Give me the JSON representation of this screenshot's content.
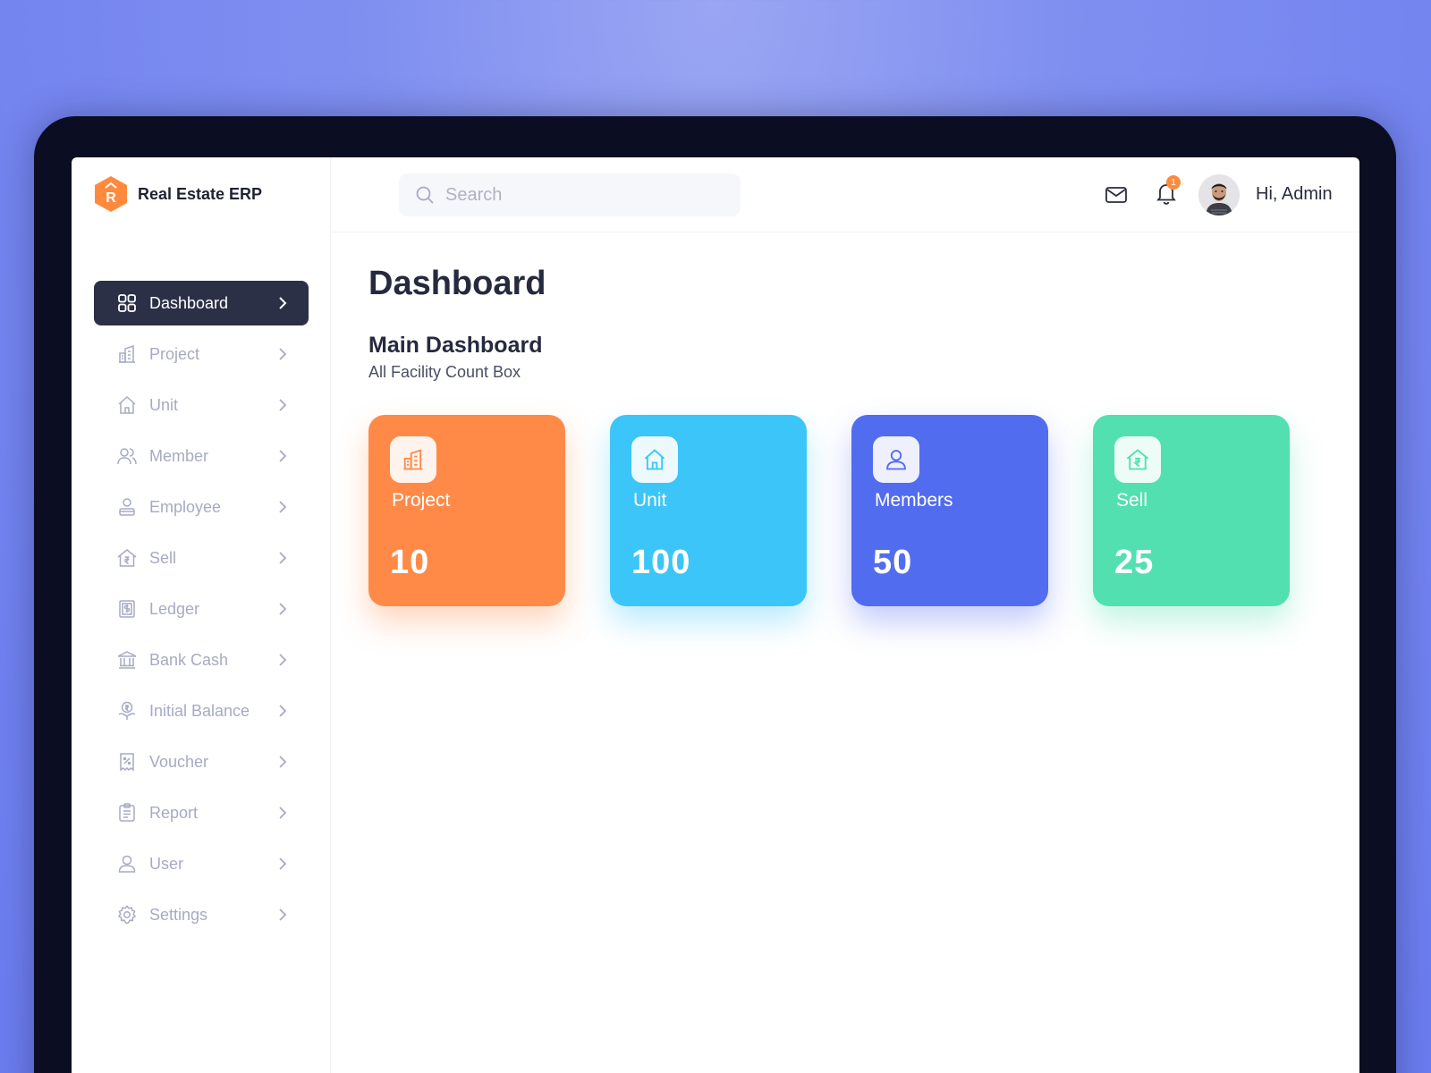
{
  "app": {
    "name": "Real Estate ERP",
    "logo_letter": "R"
  },
  "search": {
    "placeholder": "Search"
  },
  "header": {
    "notification_count": "1",
    "greeting": "Hi, Admin"
  },
  "sidebar": {
    "items": [
      {
        "label": "Dashboard",
        "icon": "grid-icon",
        "active": true
      },
      {
        "label": "Project",
        "icon": "building-icon"
      },
      {
        "label": "Unit",
        "icon": "home-icon"
      },
      {
        "label": "Member",
        "icon": "users-icon"
      },
      {
        "label": "Employee",
        "icon": "employee-icon"
      },
      {
        "label": "Sell",
        "icon": "house-rupee-icon"
      },
      {
        "label": "Ledger",
        "icon": "ledger-icon"
      },
      {
        "label": "Bank Cash",
        "icon": "bank-icon"
      },
      {
        "label": "Initial Balance",
        "icon": "balance-icon"
      },
      {
        "label": "Voucher",
        "icon": "voucher-icon"
      },
      {
        "label": "Report",
        "icon": "report-icon"
      },
      {
        "label": "User",
        "icon": "user-icon"
      },
      {
        "label": "Settings",
        "icon": "gear-icon"
      }
    ]
  },
  "main": {
    "title": "Dashboard",
    "section_title": "Main Dashboard",
    "section_subtitle": "All Facility Count Box",
    "cards": [
      {
        "label": "Project",
        "value": "10",
        "color": "#ff8a48",
        "icon": "building-icon"
      },
      {
        "label": "Unit",
        "value": "100",
        "color": "#3cc5f8",
        "icon": "home-icon"
      },
      {
        "label": "Members",
        "value": "50",
        "color": "#526cf0",
        "icon": "user-icon"
      },
      {
        "label": "Sell",
        "value": "25",
        "color": "#52e0b0",
        "icon": "house-rupee-icon"
      }
    ]
  },
  "colors": {
    "accent": "#ff8a3d",
    "sidebar_active": "#2b3047",
    "background": "#7f8ff0"
  }
}
